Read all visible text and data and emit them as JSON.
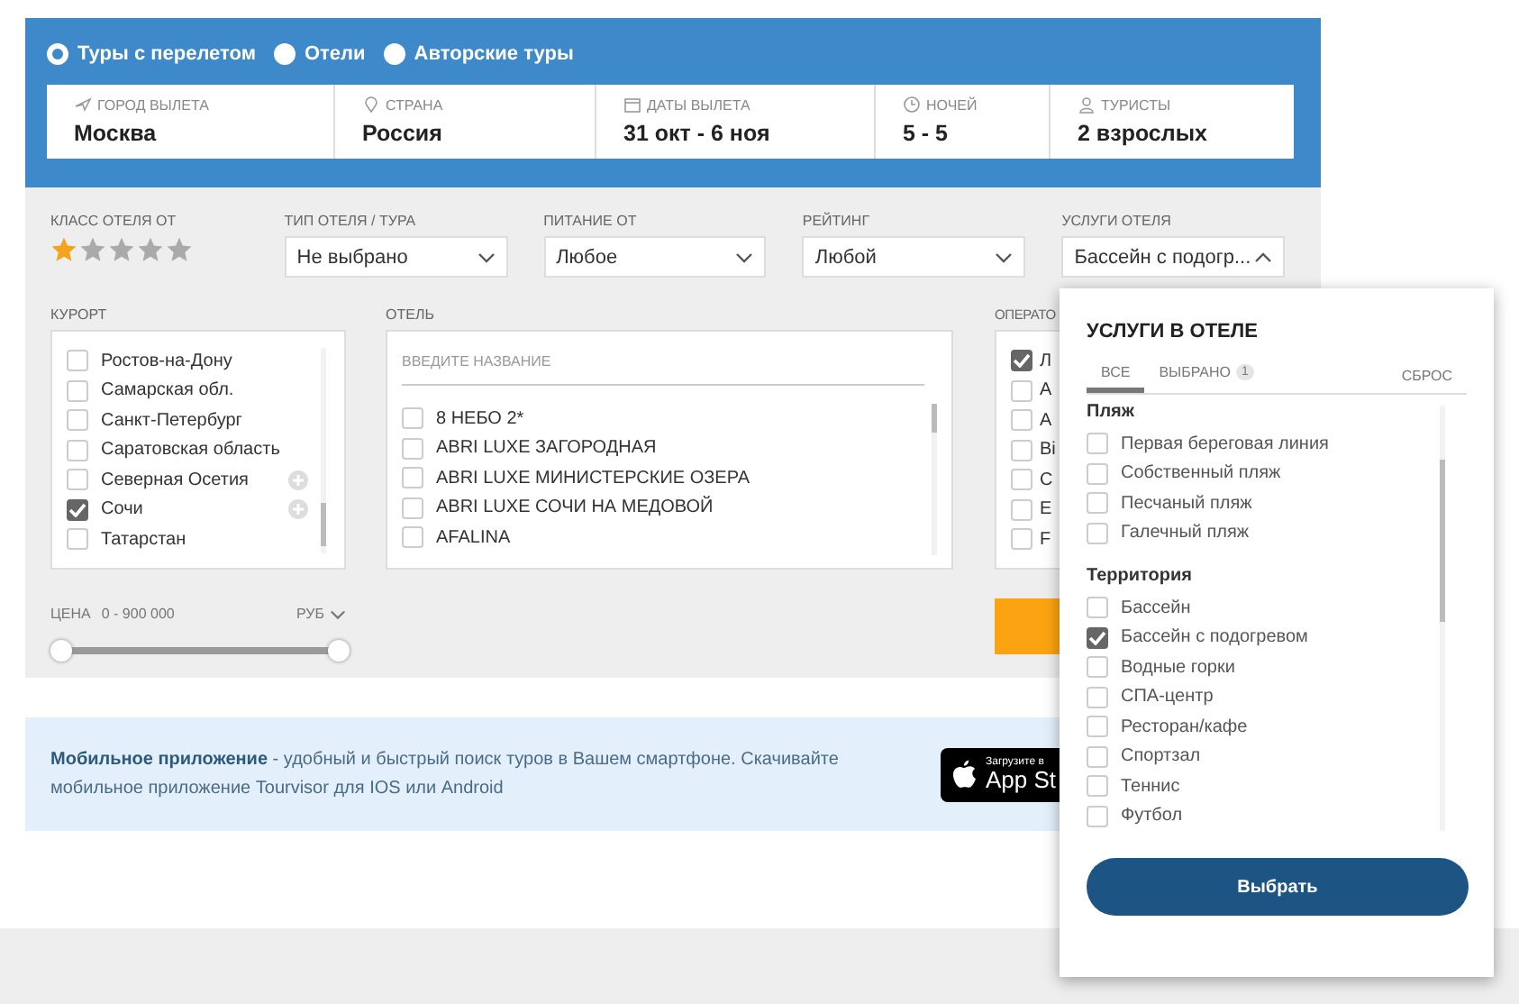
{
  "trip_types": [
    {
      "label": "Туры с перелетом",
      "selected": true
    },
    {
      "label": "Отели",
      "selected": false
    },
    {
      "label": "Авторские туры",
      "selected": false
    }
  ],
  "search_fields": [
    {
      "kind": "plane",
      "label": "ГОРОД ВЫЛЕТА",
      "value": "Москва"
    },
    {
      "kind": "pin",
      "label": "СТРАНА",
      "value": "Россия"
    },
    {
      "kind": "calendar",
      "label": "ДАТЫ ВЫЛЕТА",
      "value": "31 окт - 6 ноя"
    },
    {
      "kind": "clock",
      "label": "НОЧЕЙ",
      "value": "5 - 5"
    },
    {
      "kind": "person",
      "label": "ТУРИСТЫ",
      "value": "2 взрослых"
    }
  ],
  "hotel_class": {
    "label": "КЛАСС ОТЕЛЯ ОТ",
    "stars": 1
  },
  "selects": [
    {
      "label": "ТИП ОТЕЛЯ / ТУРА",
      "value": "Не выбрано",
      "expanded": false
    },
    {
      "label": "ПИТАНИЕ ОТ",
      "value": "Любое",
      "expanded": false
    },
    {
      "label": "РЕЙТИНГ",
      "value": "Любой",
      "expanded": false
    },
    {
      "label": "УСЛУГИ ОТЕЛЯ",
      "value": "Бассейн с подогр...",
      "expanded": true
    }
  ],
  "resorts": {
    "label": "КУРОРТ",
    "items": [
      {
        "label": "Ростов-на-Дону",
        "checked": false,
        "expandable": false
      },
      {
        "label": "Самарская обл.",
        "checked": false,
        "expandable": false
      },
      {
        "label": "Санкт-Петербург",
        "checked": false,
        "expandable": false
      },
      {
        "label": "Саратовская область",
        "checked": false,
        "expandable": false
      },
      {
        "label": "Северная Осетия",
        "checked": false,
        "expandable": true
      },
      {
        "label": "Сочи",
        "checked": true,
        "expandable": true
      },
      {
        "label": "Татарстан",
        "checked": false,
        "expandable": false
      }
    ]
  },
  "hotels": {
    "label": "ОТЕЛЬ",
    "placeholder": "ВВЕДИТЕ НАЗВАНИЕ",
    "items": [
      {
        "label": "8 НЕБО 2*",
        "checked": false
      },
      {
        "label": "ABRI LUXE ЗАГОРОДНАЯ",
        "checked": false
      },
      {
        "label": "ABRI LUXE МИНИСТЕРСКИЕ ОЗЕРА",
        "checked": false
      },
      {
        "label": "ABRI LUXE СОЧИ НА МЕДОВОЙ",
        "checked": false
      },
      {
        "label": "AFALINA",
        "checked": false
      }
    ]
  },
  "operators": {
    "label": "ОПЕРАТО",
    "items": [
      {
        "label": "Л",
        "checked": true
      },
      {
        "label": "A",
        "checked": false
      },
      {
        "label": "A",
        "checked": false
      },
      {
        "label": "Bi",
        "checked": false
      },
      {
        "label": "C",
        "checked": false
      },
      {
        "label": "E",
        "checked": false
      },
      {
        "label": "F",
        "checked": false
      }
    ]
  },
  "price": {
    "label": "ЦЕНА",
    "range": "0 -  900 000",
    "currency": "РУБ",
    "level": 1
  },
  "banner": {
    "text": "**Мобильное приложение** - удобный и быстрый поиск туров в Вашем смартфоне. Скачивайте мобильное приложение Tourvisor для IOS или Android",
    "badge_small": "Загрузите в",
    "badge_big": "App St"
  },
  "popup": {
    "title": "УСЛУГИ В ОТЕЛЕ",
    "tabs": [
      {
        "label": "ВСЕ",
        "selected": true
      },
      {
        "label": "ВЫБРАНО",
        "count": "1",
        "selected": false
      }
    ],
    "reset": "СБРОС",
    "sections": [
      {
        "title": "Пляж",
        "items": [
          {
            "label": "Первая береговая линия",
            "checked": false
          },
          {
            "label": "Собственный пляж",
            "checked": false
          },
          {
            "label": "Песчаный пляж",
            "checked": false
          },
          {
            "label": "Галечный пляж",
            "checked": false
          }
        ]
      },
      {
        "title": "Территория",
        "items": [
          {
            "label": "Бассейн",
            "checked": false
          },
          {
            "label": "Бассейн с подогревом",
            "checked": true
          },
          {
            "label": "Водные горки",
            "checked": false
          },
          {
            "label": "СПА-центр",
            "checked": false
          },
          {
            "label": "Ресторан/кафе",
            "checked": false
          },
          {
            "label": "Спортзал",
            "checked": false
          },
          {
            "label": "Теннис",
            "checked": false
          },
          {
            "label": "Футбол",
            "checked": false
          }
        ]
      }
    ],
    "button": "Выбрать"
  }
}
